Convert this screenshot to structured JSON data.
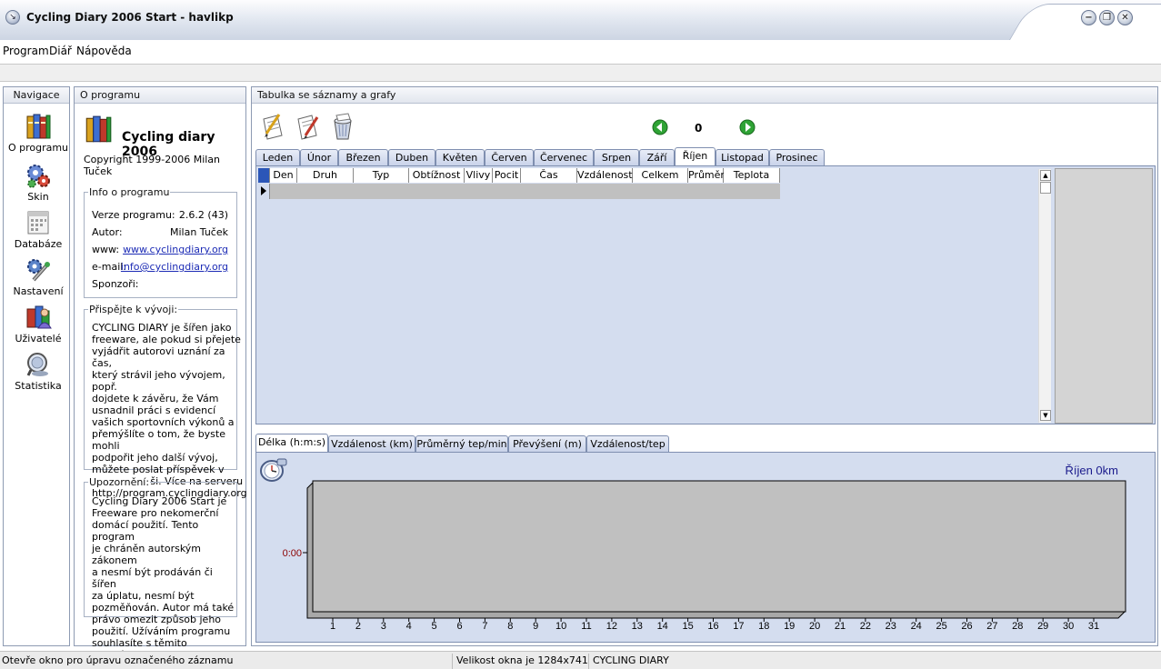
{
  "window": {
    "title": "Cycling Diary 2006 Start - havlikp",
    "minimize": "−",
    "restore": "❐",
    "close": "✕"
  },
  "menu": [
    {
      "label": "Program"
    },
    {
      "label": "Diář"
    },
    {
      "label": "Nápověda"
    }
  ],
  "navigation": {
    "header": "Navigace",
    "items": [
      {
        "label": "O programu",
        "icon": "books-icon"
      },
      {
        "label": "Skin",
        "icon": "gears-icon"
      },
      {
        "label": "Databáze",
        "icon": "calendar-icon"
      },
      {
        "label": "Nastavení",
        "icon": "tools-icon"
      },
      {
        "label": "Uživatelé",
        "icon": "users-icon"
      },
      {
        "label": "Statistika",
        "icon": "magnifier-icon"
      }
    ]
  },
  "about": {
    "header": "O programu",
    "app_name": "Cycling diary 2006",
    "copyright": "Copyright 1999-2006 Milan Tuček",
    "info": {
      "title": "Info o programu",
      "version_label": "Verze programu:",
      "version_value": "2.6.2 (43)",
      "author_label": "Autor:",
      "author_value": "Milan Tuček",
      "www_label": "www:",
      "www_value": "www.cyclingdiary.org",
      "email_label": "e-mail:",
      "email_value": "info@cyclingdiary.org",
      "sponsors_label": "Sponzoři:"
    },
    "contribute": {
      "title": "Přispějte k vývoji:",
      "lines": [
        "CYCLING DIARY je šířen jako",
        "freeware, ale pokud si přejete",
        "vyjádřit autorovi uznání za čas,",
        "který strávil jeho vývojem, popř.",
        "dojdete k závěru, že Vám",
        "usnadnil práci s evidencí",
        "vašich sportovních výkonů a",
        "přemýšlíte o tom, že byste mohli",
        "podpořit jeho další vývoj,",
        "můžete poslat příspěvek v",
        "jakékoliv výši. Více na serveru",
        "http://program.cyclingdiary.org"
      ]
    },
    "notice": {
      "title": "Upozornění:",
      "lines": [
        "Cycling Diary 2006 Start je",
        "Freeware pro nekomerční",
        "domácí použití. Tento program",
        "je chráněn autorským zákonem",
        "a nesmí být prodáván či šířen",
        "za úplatu, nesmí být",
        "pozměňován. Autor má také",
        "právo omezit způsob jeho",
        "použití.  Užíváním programu",
        "souhlasíte s těmito podmínkami."
      ]
    }
  },
  "main": {
    "header": "Tabulka se sáznamy a grafy",
    "year_value": "0",
    "months": [
      "Leden",
      "Únor",
      "Březen",
      "Duben",
      "Květen",
      "Červen",
      "Červenec",
      "Srpen",
      "Září",
      "Říjen",
      "Listopad",
      "Prosinec"
    ],
    "active_month": "Říjen",
    "columns": [
      "Den",
      "Druh",
      "Typ",
      "Obtížnost",
      "Vlivy",
      "Pocit",
      "Čas",
      "Vzdálenost",
      "Celkem",
      "Průměr",
      "Teplota"
    ],
    "chart_tabs": [
      "Délka (h:m:s)",
      "Vzdálenost (km)",
      "Průměrný tep/min",
      "Převýšení (m)",
      "Vzdálenost/tep"
    ],
    "active_chart_tab": "Délka (h:m:s)"
  },
  "chart_data": {
    "type": "bar",
    "title": "Říjen 0km",
    "categories": [
      "1",
      "2",
      "3",
      "4",
      "5",
      "6",
      "7",
      "8",
      "9",
      "10",
      "11",
      "12",
      "13",
      "14",
      "15",
      "16",
      "17",
      "18",
      "19",
      "20",
      "21",
      "22",
      "23",
      "24",
      "25",
      "26",
      "27",
      "28",
      "29",
      "30",
      "31"
    ],
    "values": [
      0,
      0,
      0,
      0,
      0,
      0,
      0,
      0,
      0,
      0,
      0,
      0,
      0,
      0,
      0,
      0,
      0,
      0,
      0,
      0,
      0,
      0,
      0,
      0,
      0,
      0,
      0,
      0,
      0,
      0,
      0
    ],
    "y_tick_label": "0:00",
    "colors": {
      "plot_bg": "#c0c0c0",
      "title": "#1a1a8c",
      "y_label": "#8b0000"
    }
  },
  "status": {
    "hint": "Otevře okno pro úpravu označeného záznamu",
    "size": "Velikost okna je 1284x741",
    "app": "CYCLING DIARY"
  }
}
